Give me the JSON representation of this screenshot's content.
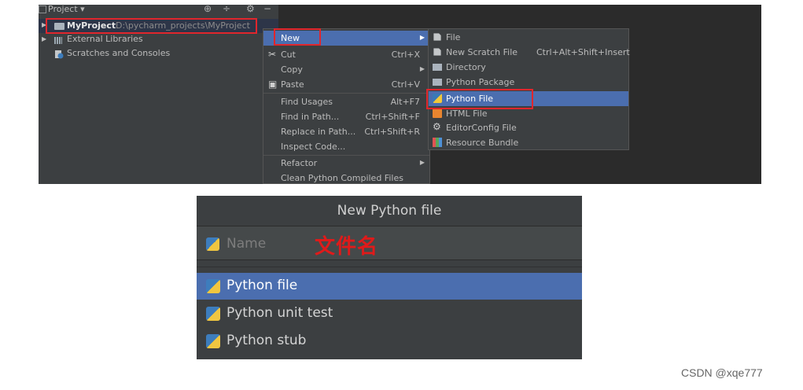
{
  "project_panel": {
    "toolbar_label": "Project ▾",
    "tools": [
      "⊕",
      "÷",
      "⚙",
      "−"
    ],
    "tree": {
      "root_name": "MyProject",
      "root_path": "D:\\pycharm_projects\\MyProject",
      "external_libraries": "External Libraries",
      "scratches": "Scratches and Consoles"
    }
  },
  "context_menu": {
    "items": [
      {
        "label": "New",
        "shortcut": "",
        "submenu": true
      },
      {
        "label": "Cut",
        "shortcut": "Ctrl+X"
      },
      {
        "label": "Copy",
        "shortcut": "",
        "submenu": true
      },
      {
        "label": "Paste",
        "shortcut": "Ctrl+V"
      },
      {
        "label": "Find Usages",
        "shortcut": "Alt+F7"
      },
      {
        "label": "Find in Path...",
        "shortcut": "Ctrl+Shift+F"
      },
      {
        "label": "Replace in Path...",
        "shortcut": "Ctrl+Shift+R"
      },
      {
        "label": "Inspect Code..."
      },
      {
        "label": "Refactor",
        "submenu": true
      },
      {
        "label": "Clean Python Compiled Files"
      }
    ]
  },
  "new_submenu": {
    "items": [
      {
        "label": "File",
        "shortcut": ""
      },
      {
        "label": "New Scratch File",
        "shortcut": "Ctrl+Alt+Shift+Insert"
      },
      {
        "label": "Directory",
        "shortcut": ""
      },
      {
        "label": "Python Package",
        "shortcut": ""
      },
      {
        "label": "Python File",
        "shortcut": ""
      },
      {
        "label": "HTML File",
        "shortcut": ""
      },
      {
        "label": "EditorConfig File",
        "shortcut": ""
      },
      {
        "label": "Resource Bundle",
        "shortcut": ""
      }
    ]
  },
  "dialog": {
    "title": "New Python file",
    "name_placeholder": "Name",
    "annotation": "文件名",
    "options": [
      "Python file",
      "Python unit test",
      "Python stub"
    ]
  },
  "watermark": "CSDN @xqe777",
  "colors": {
    "selection": "#4b6eaf",
    "highlight_box": "#e0262c",
    "annotation": "#e01a1a"
  }
}
